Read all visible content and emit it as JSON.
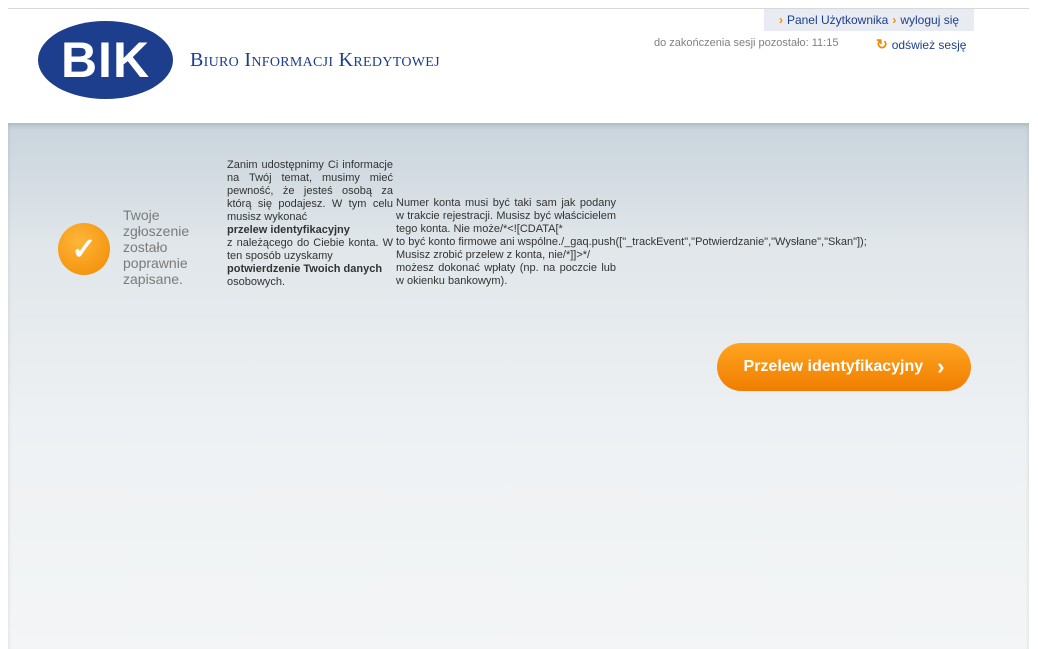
{
  "header": {
    "logo_text": "BIK",
    "company_name": "Biuro Informacji Kredytowej",
    "nav": {
      "panel_label": "Panel Użytkownika",
      "logout_label": "wyloguj się"
    },
    "session_text": "do zakończenia sesji pozostało: 11:15",
    "refresh_label": "odśwież sesję"
  },
  "main": {
    "status_text": "Twoje zgłoszenie zostało poprawnie zapisane.",
    "col1": {
      "p1": "Zanim udostępnimy Ci informacje na Twój temat, musimy mieć pewność, że jesteś osobą za którą się podajesz. W tym celu musisz wykonać",
      "b1": "przelew identyfikacyjny",
      "p2": "z należącego do Ciebie konta. W ten sposób uzyskamy",
      "b2": "potwierdzenie Twoich danych",
      "p3": "osobowych."
    },
    "col2": {
      "p1": "Numer konta musi być taki sam jak podany w trakcie rejestracji. Musisz być właścicielem tego konta. Nie może/*<![CDATA[*",
      "p2": "to być konto firmowe ani wspólne./_gaq.push([\"_trackEvent\",\"Potwierdzanie\",\"Wysłane\",\"Skan\"]);",
      "p3": "Musisz zrobić przelew z konta, nie/*]]>*/",
      "p4": "możesz dokonać wpłaty (np. na poczcie lub w okienku bankowym)."
    },
    "button_label": "Przelew identyfikacyjny"
  },
  "colors": {
    "brand_blue": "#1d3e8c",
    "accent_orange": "#f08a00"
  },
  "icons": {
    "check": "check-circle-icon",
    "chevron": "chevron-right-icon",
    "refresh": "refresh-icon"
  }
}
